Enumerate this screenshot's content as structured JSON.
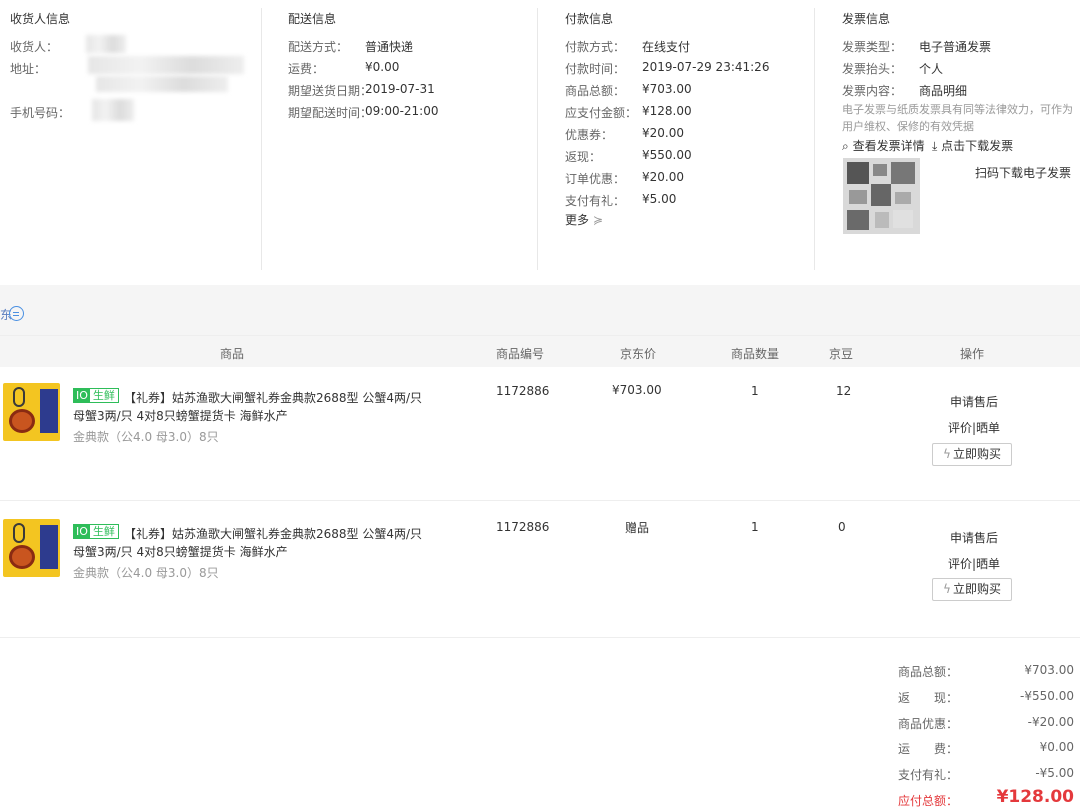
{
  "receiver": {
    "title": "收货人信息",
    "name_label": "收货人：",
    "address_label": "地址：",
    "phone_label": "手机号码："
  },
  "delivery": {
    "title": "配送信息",
    "method_label": "配送方式：",
    "method_value": "普通快递",
    "fee_label": "运费：",
    "fee_value": "¥0.00",
    "date_label": "期望送货日期：",
    "date_value": "2019-07-31",
    "time_label": "期望配送时间：",
    "time_value": "09:00-21:00"
  },
  "payment": {
    "title": "付款信息",
    "rows": [
      {
        "label": "付款方式：",
        "value": "在线支付"
      },
      {
        "label": "付款时间：",
        "value": "2019-07-29 23:41:26"
      },
      {
        "label": "商品总额：",
        "value": "¥703.00"
      },
      {
        "label": "应支付金额：",
        "value": "¥128.00"
      },
      {
        "label": "优惠券：",
        "value": "¥20.00"
      },
      {
        "label": "返现：",
        "value": "¥550.00"
      },
      {
        "label": "订单优惠：",
        "value": "¥20.00"
      },
      {
        "label": "支付有礼：",
        "value": "¥5.00"
      }
    ],
    "more": "更多"
  },
  "invoice": {
    "title": "发票信息",
    "type_label": "发票类型：",
    "type_value": "电子普通发票",
    "header_label": "发票抬头：",
    "header_value": "个人",
    "content_label": "发票内容：",
    "content_value": "商品明细",
    "note_line1": "电子发票与纸质发票具有同等法律效力，可作为",
    "note_line2": "用户维权、保修的有效凭据",
    "view_link": "查看发票详情",
    "download_link": "点击下载发票",
    "qr_text": "扫码下载电子发票"
  },
  "band": {
    "text": "东"
  },
  "table": {
    "headers": {
      "product": "商品",
      "sku": "商品编号",
      "price": "京东价",
      "qty": "商品数量",
      "beans": "京豆",
      "action": "操作"
    },
    "items": [
      {
        "badge_a": "IO",
        "badge_b": "生鲜",
        "title_line1": "【礼券】姑苏渔歌大闸蟹礼券金典款2688型 公蟹4两/只",
        "title_line2": "母蟹3两/只 4对8只螃蟹提货卡 海鲜水产",
        "spec": "金典款（公4.0 母3.0）8只",
        "sku": "1172886",
        "price": "¥703.00",
        "qty": "1",
        "beans": "12",
        "op_service": "申请售后",
        "op_review": "评价|晒单",
        "op_buy": "立即购买"
      },
      {
        "badge_a": "IO",
        "badge_b": "生鲜",
        "title_line1": "【礼券】姑苏渔歌大闸蟹礼券金典款2688型 公蟹4两/只",
        "title_line2": "母蟹3两/只 4对8只螃蟹提货卡 海鲜水产",
        "spec": "金典款（公4.0 母3.0）8只",
        "sku": "1172886",
        "price": "赠品",
        "qty": "1",
        "beans": "0",
        "op_service": "申请售后",
        "op_review": "评价|晒单",
        "op_buy": "立即购买"
      }
    ]
  },
  "summary": {
    "rows": [
      {
        "label": "商品总额：",
        "value": "¥703.00"
      },
      {
        "label": "返　　现：",
        "value": "-¥550.00"
      },
      {
        "label": "商品优惠：",
        "value": "-¥20.00"
      },
      {
        "label": "运　　费：",
        "value": "¥0.00"
      },
      {
        "label": "支付有礼：",
        "value": "-¥5.00"
      }
    ],
    "total_label": "应付总额：",
    "total_value": "¥128.00"
  },
  "colors": {
    "accent_red": "#e4393c",
    "fresh_green": "#2ebd59",
    "link_blue": "#4a90e2"
  }
}
